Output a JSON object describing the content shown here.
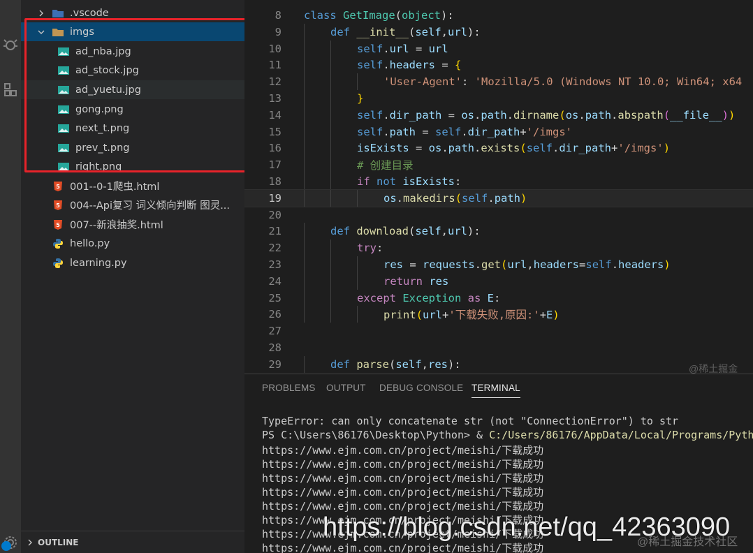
{
  "sidebar": {
    "items": [
      {
        "label": ".vscode",
        "kind": "folder",
        "expanded": false
      },
      {
        "label": "imgs",
        "kind": "folder",
        "expanded": true
      },
      {
        "label": "ad_nba.jpg",
        "kind": "image"
      },
      {
        "label": "ad_stock.jpg",
        "kind": "image"
      },
      {
        "label": "ad_yuetu.jpg",
        "kind": "image"
      },
      {
        "label": "gong.png",
        "kind": "image"
      },
      {
        "label": "next_t.png",
        "kind": "image"
      },
      {
        "label": "prev_t.png",
        "kind": "image"
      },
      {
        "label": "right.png",
        "kind": "image"
      },
      {
        "label": "001--0-1爬虫.html",
        "kind": "html"
      },
      {
        "label": "004--Api复习 词义倾向判断 图灵...",
        "kind": "html"
      },
      {
        "label": "007--新浪抽奖.html",
        "kind": "html"
      },
      {
        "label": "hello.py",
        "kind": "python"
      },
      {
        "label": "learning.py",
        "kind": "python"
      }
    ],
    "outline_label": "OUTLINE"
  },
  "editor": {
    "lines": [
      {
        "num": "8",
        "indent": 0,
        "tokens": [
          [
            "kw",
            "class "
          ],
          [
            "cls",
            "GetImage"
          ],
          [
            "plain",
            "("
          ],
          [
            "cls",
            "object"
          ],
          [
            "plain",
            "):"
          ]
        ]
      },
      {
        "num": "9",
        "indent": 1,
        "tokens": [
          [
            "kw",
            "def "
          ],
          [
            "fn",
            "__init__"
          ],
          [
            "plain",
            "("
          ],
          [
            "par",
            "self"
          ],
          [
            "plain",
            ","
          ],
          [
            "par",
            "url"
          ],
          [
            "plain",
            "):"
          ]
        ]
      },
      {
        "num": "10",
        "indent": 2,
        "tokens": [
          [
            "kw",
            "self"
          ],
          [
            "plain",
            "."
          ],
          [
            "par",
            "url"
          ],
          [
            "plain",
            " = "
          ],
          [
            "par",
            "url"
          ]
        ]
      },
      {
        "num": "11",
        "indent": 2,
        "tokens": [
          [
            "kw",
            "self"
          ],
          [
            "plain",
            "."
          ],
          [
            "par",
            "headers"
          ],
          [
            "plain",
            " = "
          ],
          [
            "brace",
            "{"
          ]
        ]
      },
      {
        "num": "12",
        "indent": 3,
        "tokens": [
          [
            "str",
            "'User-Agent'"
          ],
          [
            "plain",
            ": "
          ],
          [
            "str",
            "'Mozilla/5.0 (Windows NT 10.0; Win64; x64"
          ]
        ]
      },
      {
        "num": "13",
        "indent": 2,
        "tokens": [
          [
            "brace",
            "}"
          ]
        ]
      },
      {
        "num": "14",
        "indent": 2,
        "tokens": [
          [
            "kw",
            "self"
          ],
          [
            "plain",
            "."
          ],
          [
            "par",
            "dir_path"
          ],
          [
            "plain",
            " = "
          ],
          [
            "par",
            "os"
          ],
          [
            "plain",
            "."
          ],
          [
            "par",
            "path"
          ],
          [
            "plain",
            "."
          ],
          [
            "fn",
            "dirname"
          ],
          [
            "brace",
            "("
          ],
          [
            "par",
            "os"
          ],
          [
            "plain",
            "."
          ],
          [
            "par",
            "path"
          ],
          [
            "plain",
            "."
          ],
          [
            "fn",
            "abspath"
          ],
          [
            "brace2",
            "("
          ],
          [
            "par",
            "__file__"
          ],
          [
            "brace2",
            ")"
          ],
          [
            "brace",
            ")"
          ]
        ]
      },
      {
        "num": "15",
        "indent": 2,
        "tokens": [
          [
            "kw",
            "self"
          ],
          [
            "plain",
            "."
          ],
          [
            "par",
            "path"
          ],
          [
            "plain",
            " = "
          ],
          [
            "kw",
            "self"
          ],
          [
            "plain",
            "."
          ],
          [
            "par",
            "dir_path"
          ],
          [
            "plain",
            "+"
          ],
          [
            "str",
            "'/imgs'"
          ]
        ]
      },
      {
        "num": "16",
        "indent": 2,
        "tokens": [
          [
            "par",
            "isExists"
          ],
          [
            "plain",
            " = "
          ],
          [
            "par",
            "os"
          ],
          [
            "plain",
            "."
          ],
          [
            "par",
            "path"
          ],
          [
            "plain",
            "."
          ],
          [
            "fn",
            "exists"
          ],
          [
            "brace",
            "("
          ],
          [
            "kw",
            "self"
          ],
          [
            "plain",
            "."
          ],
          [
            "par",
            "dir_path"
          ],
          [
            "plain",
            "+"
          ],
          [
            "str",
            "'/imgs'"
          ],
          [
            "brace",
            ")"
          ]
        ]
      },
      {
        "num": "17",
        "indent": 2,
        "tokens": [
          [
            "com",
            "# 创建目录"
          ]
        ]
      },
      {
        "num": "18",
        "indent": 2,
        "tokens": [
          [
            "ctl",
            "if "
          ],
          [
            "kw",
            "not "
          ],
          [
            "par",
            "isExists"
          ],
          [
            "plain",
            ":"
          ]
        ]
      },
      {
        "num": "19",
        "indent": 3,
        "current": true,
        "tokens": [
          [
            "par",
            "os"
          ],
          [
            "plain",
            "."
          ],
          [
            "fn",
            "makedirs"
          ],
          [
            "brace",
            "("
          ],
          [
            "kw",
            "self"
          ],
          [
            "plain",
            "."
          ],
          [
            "par",
            "path"
          ],
          [
            "brace",
            ")"
          ]
        ]
      },
      {
        "num": "20",
        "indent": 0,
        "tokens": []
      },
      {
        "num": "21",
        "indent": 1,
        "tokens": [
          [
            "kw",
            "def "
          ],
          [
            "fn",
            "download"
          ],
          [
            "plain",
            "("
          ],
          [
            "par",
            "self"
          ],
          [
            "plain",
            ","
          ],
          [
            "par",
            "url"
          ],
          [
            "plain",
            "):"
          ]
        ]
      },
      {
        "num": "22",
        "indent": 2,
        "tokens": [
          [
            "ctl",
            "try"
          ],
          [
            "plain",
            ":"
          ]
        ]
      },
      {
        "num": "23",
        "indent": 3,
        "tokens": [
          [
            "par",
            "res"
          ],
          [
            "plain",
            " = "
          ],
          [
            "par",
            "requests"
          ],
          [
            "plain",
            "."
          ],
          [
            "fn",
            "get"
          ],
          [
            "brace",
            "("
          ],
          [
            "par",
            "url"
          ],
          [
            "plain",
            ","
          ],
          [
            "par",
            "headers"
          ],
          [
            "plain",
            "="
          ],
          [
            "kw",
            "self"
          ],
          [
            "plain",
            "."
          ],
          [
            "par",
            "headers"
          ],
          [
            "brace",
            ")"
          ]
        ]
      },
      {
        "num": "24",
        "indent": 3,
        "tokens": [
          [
            "ctl",
            "return "
          ],
          [
            "par",
            "res"
          ]
        ]
      },
      {
        "num": "25",
        "indent": 2,
        "tokens": [
          [
            "ctl",
            "except "
          ],
          [
            "cls",
            "Exception "
          ],
          [
            "ctl",
            "as "
          ],
          [
            "par",
            "E"
          ],
          [
            "plain",
            ":"
          ]
        ]
      },
      {
        "num": "26",
        "indent": 3,
        "tokens": [
          [
            "fn",
            "print"
          ],
          [
            "brace",
            "("
          ],
          [
            "par",
            "url"
          ],
          [
            "plain",
            "+"
          ],
          [
            "str",
            "'下载失败,原因:'"
          ],
          [
            "plain",
            "+"
          ],
          [
            "par",
            "E"
          ],
          [
            "brace",
            ")"
          ]
        ]
      },
      {
        "num": "27",
        "indent": 0,
        "tokens": []
      },
      {
        "num": "28",
        "indent": 0,
        "tokens": []
      },
      {
        "num": "29",
        "indent": 1,
        "tokens": [
          [
            "kw",
            "def "
          ],
          [
            "fn",
            "parse"
          ],
          [
            "plain",
            "("
          ],
          [
            "par",
            "self"
          ],
          [
            "plain",
            ","
          ],
          [
            "par",
            "res"
          ],
          [
            "plain",
            "):"
          ]
        ]
      }
    ]
  },
  "panel": {
    "tabs": [
      "PROBLEMS",
      "OUTPUT",
      "DEBUG CONSOLE",
      "TERMINAL"
    ],
    "active_tab": "TERMINAL",
    "terminal": {
      "error_line": "TypeError: can only concatenate str (not \"ConnectionError\") to str",
      "prompt_prefix": "PS C:\\Users\\86176\\Desktop\\Python> & ",
      "prompt_path": "C:/Users/86176/AppData/Local/Programs/Pyth",
      "success_lines": [
        "https://www.ejm.com.cn/project/meishi/下载成功",
        "https://www.ejm.com.cn/project/meishi/下载成功",
        "https://www.ejm.com.cn/project/meishi/下载成功",
        "https://www.ejm.com.cn/project/meishi/下载成功",
        "https://www.ejm.com.cn/project/meishi/下载成功",
        "https://www.ejm.com.cn/project/meishi/下载成功",
        "https://www.ejm.com.cn/project/meishi/下载成功",
        "https://www.ejm.com.cn/project/meishi/下载成功"
      ]
    }
  },
  "watermarks": {
    "csdn": "https://blog.csdn.net/qq_42363090",
    "juejin": "@稀土掘金技术社区",
    "juejin_small": "@稀土掘金"
  },
  "colors": {
    "highlight_box": "#e8232a",
    "selection": "#094771",
    "accent": "#007acc"
  }
}
